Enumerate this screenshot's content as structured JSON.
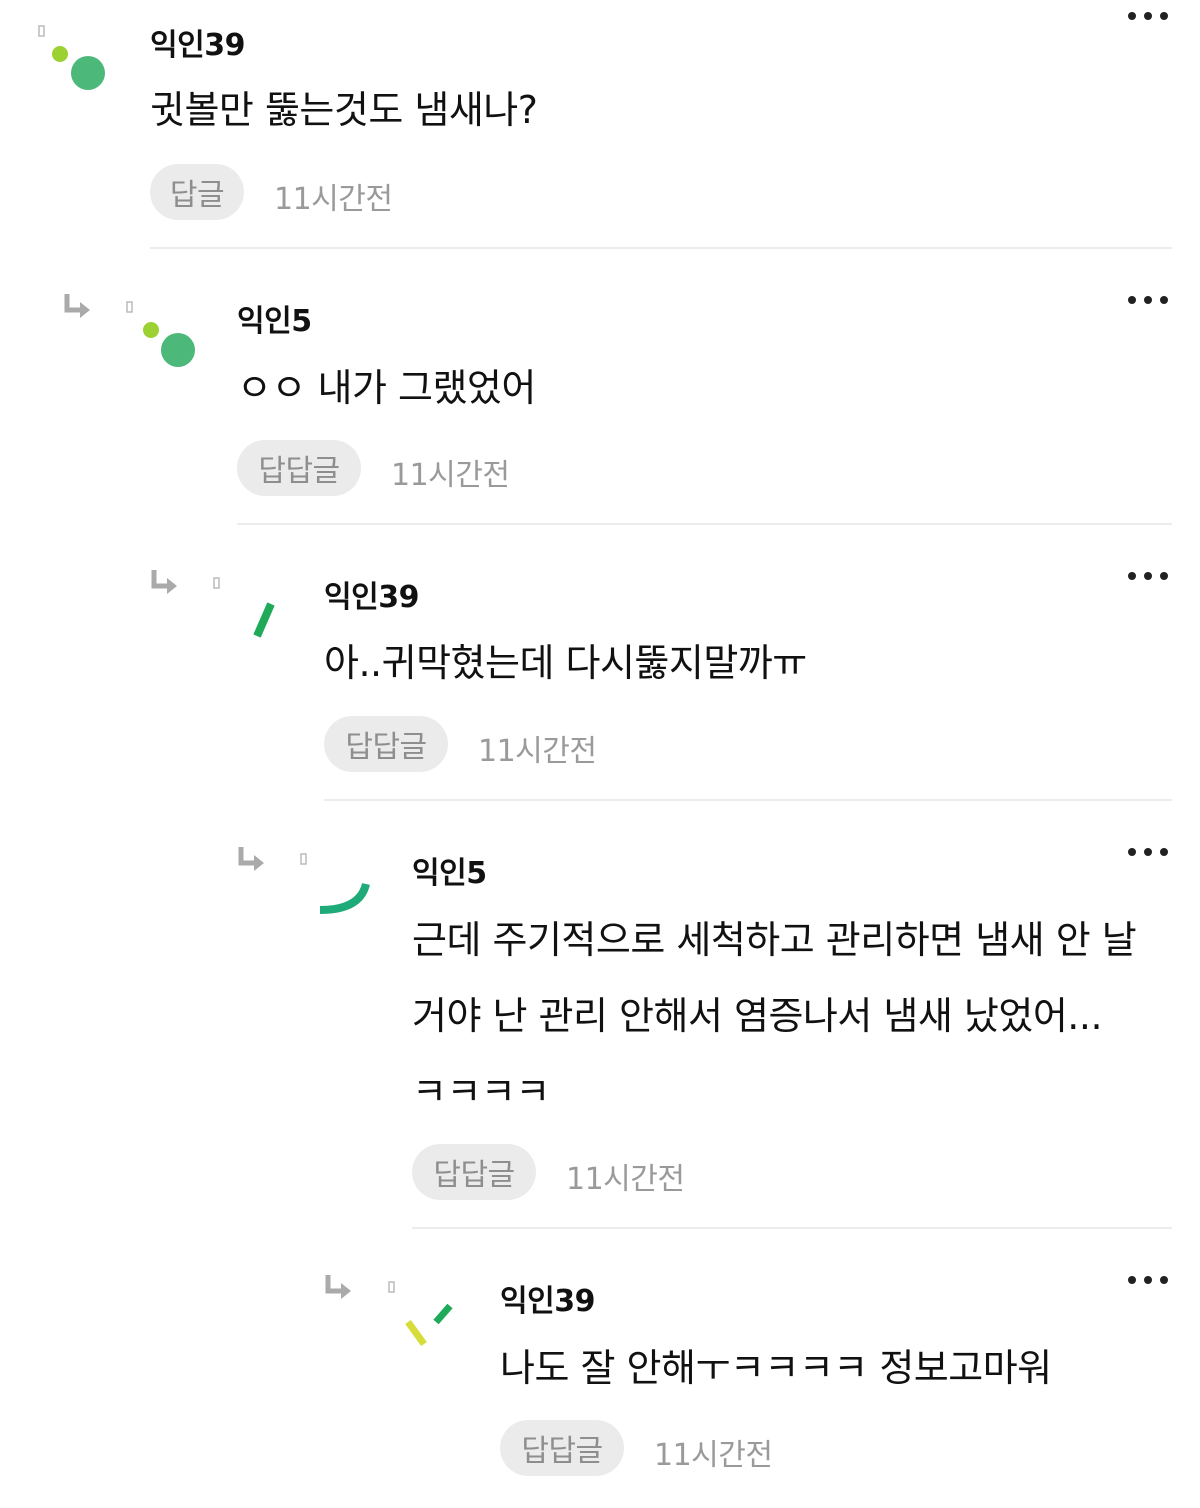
{
  "comments": [
    {
      "author": "익인39",
      "text": "귓볼만 뚫는것도 냄새나?",
      "reply_label": "답글",
      "time": "11시간전"
    },
    {
      "author": "익인5",
      "text": "ㅇㅇ 내가 그랬었어",
      "reply_label": "답답글",
      "time": "11시간전"
    },
    {
      "author": "익인39",
      "text": "아..귀막혔는데 다시뚫지말까ㅠ",
      "reply_label": "답답글",
      "time": "11시간전"
    },
    {
      "author": "익인5",
      "text": "근데 주기적으로 세척하고 관리하면 냄새 안 날 거야 난 관리 안해서 염증나서 냄새 났었어...ㅋㅋㅋㅋ",
      "reply_label": "답답글",
      "time": "11시간전"
    },
    {
      "author": "익인39",
      "text": "나도 잘 안해ㅜㅋㅋㅋㅋ 정보고마워",
      "reply_label": "답답글",
      "time": "11시간전"
    }
  ],
  "icons": {
    "more": "more-horizontal-icon",
    "reply_arrow": "reply-arrow-icon",
    "avatar": "avatar-icon"
  },
  "colors": {
    "avatar_green": "#4cb87a",
    "avatar_lime": "#9bd132",
    "avatar_yellow": "#d6dc3a",
    "button_bg": "#ebebeb",
    "muted_text": "#9a9a9a"
  }
}
